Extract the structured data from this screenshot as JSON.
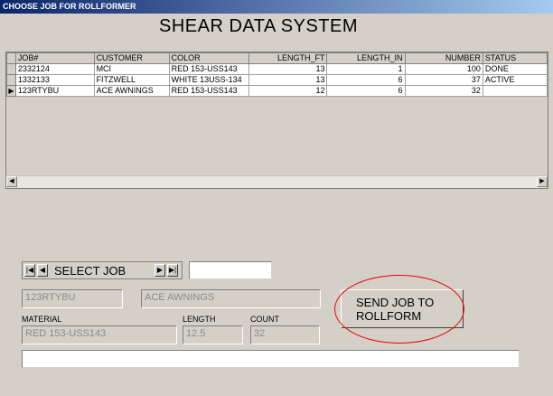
{
  "window": {
    "title": "CHOOSE JOB FOR ROLLFORMER"
  },
  "heading": "SHEAR DATA SYSTEM",
  "grid": {
    "columns": [
      "JOB#",
      "CUSTOMER",
      "COLOR",
      "LENGTH_FT",
      "LENGTH_IN",
      "NUMBER",
      "STATUS"
    ],
    "rows": [
      [
        "2332124",
        "MCI",
        "RED  153-USS143",
        "13",
        "1",
        "100",
        "DONE"
      ],
      [
        "1332133",
        "FITZWELL",
        "WHITE 13USS-134",
        "13",
        "6",
        "37",
        "ACTIVE"
      ],
      [
        "123RTYBU",
        "ACE AWNINGS",
        "RED  153-USS143",
        "12",
        "6",
        "32",
        ""
      ]
    ],
    "current_row_marker": "▶"
  },
  "navigator": {
    "first": "|◀",
    "prev": "◀",
    "label": "SELECT JOB",
    "next": "▶",
    "last": "▶|"
  },
  "form": {
    "job": "123RTYBU",
    "customer": "ACE AWNINGS",
    "material_label": "MATERIAL",
    "material": "RED  153-USS143",
    "length_label": "LENGTH",
    "length": "12.5",
    "count_label": "COUNT",
    "count": "32"
  },
  "send_button": {
    "line1": "SEND JOB TO",
    "line2": "ROLLFORM"
  },
  "colors": {
    "title_bar": "#0a246a",
    "annotation_circle": "#e00000",
    "background": "#d4d0c8"
  }
}
